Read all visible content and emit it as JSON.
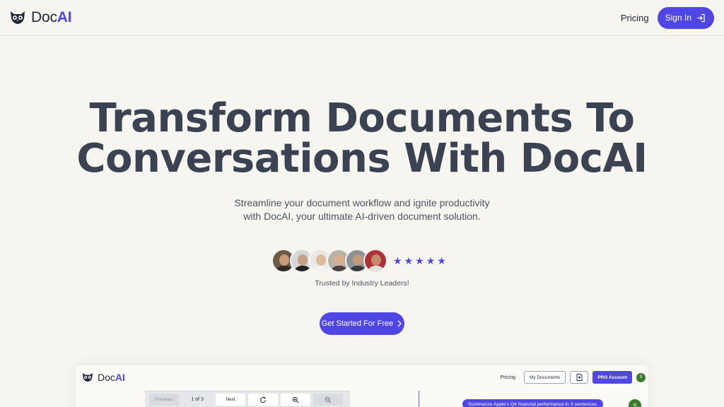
{
  "header": {
    "brand_prefix": "Doc",
    "brand_suffix": "AI",
    "pricing_label": "Pricing",
    "signin_label": "Sign In"
  },
  "hero": {
    "title_line1": "Transform Documents To",
    "title_line2": "Conversations With DocAI",
    "subtitle_line1": "Streamline your document workflow and ignite productivity",
    "subtitle_line2": "with DocAI, your ultimate AI-driven document solution.",
    "trusted_label": "Trusted by Industry Leaders!",
    "rating_stars": 5,
    "cta_label": "Get Started For Free"
  },
  "preview": {
    "brand_prefix": "Doc",
    "brand_suffix": "AI",
    "pricing_label": "Pricing",
    "my_documents_label": "My Documents",
    "pro_label": "PRO Account",
    "user_initial": "S",
    "toolbar": {
      "previous_label": "Previous",
      "page_indicator": "1 of 3",
      "next_label": "Next"
    },
    "chat_message": "Summarize Apple's Q4 financial performance in 3 sentences."
  },
  "colors": {
    "accent": "#4f46e5",
    "background": "#f7f5f0",
    "heading": "#3b4252",
    "user_avatar": "#3b7a2a"
  },
  "icons": [
    "owl-logo-icon",
    "sign-in-arrow-icon",
    "star-icon",
    "chevron-right-icon",
    "file-icon",
    "rotate-icon",
    "zoom-in-icon",
    "zoom-out-icon"
  ]
}
